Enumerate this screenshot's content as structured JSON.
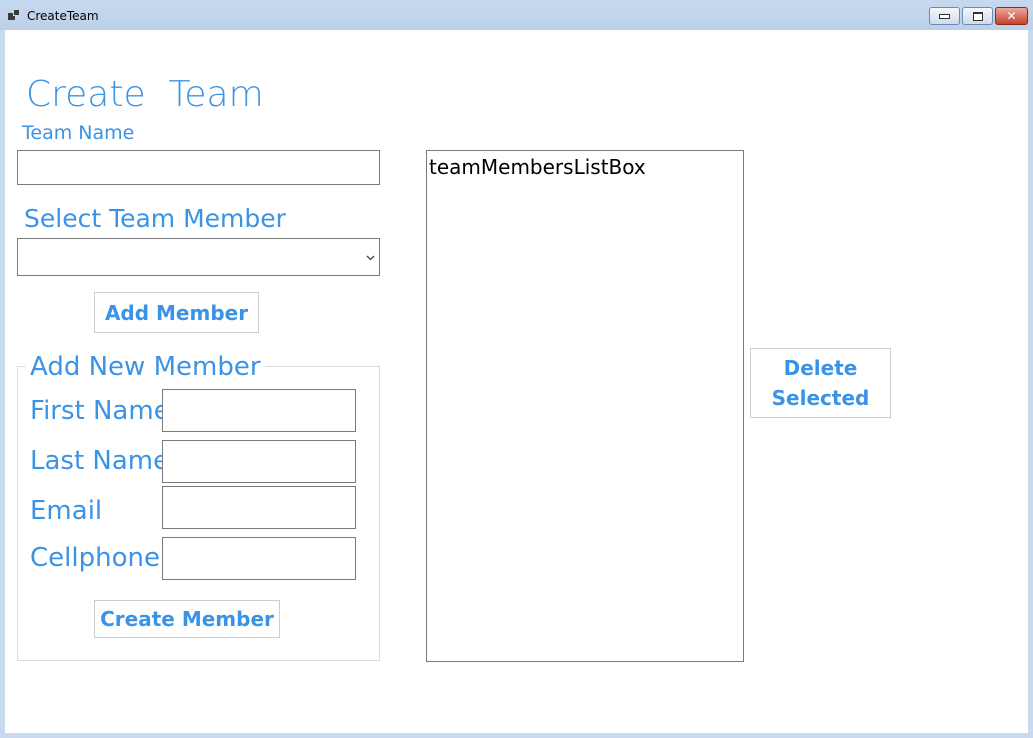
{
  "window": {
    "title": "CreateTeam",
    "icons": {
      "app": "app-icon",
      "minimize": "minimize-icon",
      "maximize": "maximize-icon",
      "close": "close-icon"
    }
  },
  "form": {
    "header": "Create  Team",
    "team_name_label": "Team Name",
    "team_name_value": "",
    "select_member_label": "Select Team Member",
    "select_member_value": "",
    "add_member_button": "Add Member",
    "new_member_group": {
      "title": "Add New Member",
      "first_name_label": "First Name",
      "first_name_value": "",
      "last_name_label": "Last Name",
      "last_name_value": "",
      "email_label": "Email",
      "email_value": "",
      "cellphone_label": "Cellphone",
      "cellphone_value": "",
      "create_button": "Create Member"
    },
    "list_box": {
      "items": [
        "teamMembersListBox"
      ]
    },
    "delete_button_line1": "Delete",
    "delete_button_line2": "Selected"
  },
  "colors": {
    "accent_text": "#3b93e5",
    "titlebar": "#c6d9ee",
    "close_button": "#c9412b"
  }
}
